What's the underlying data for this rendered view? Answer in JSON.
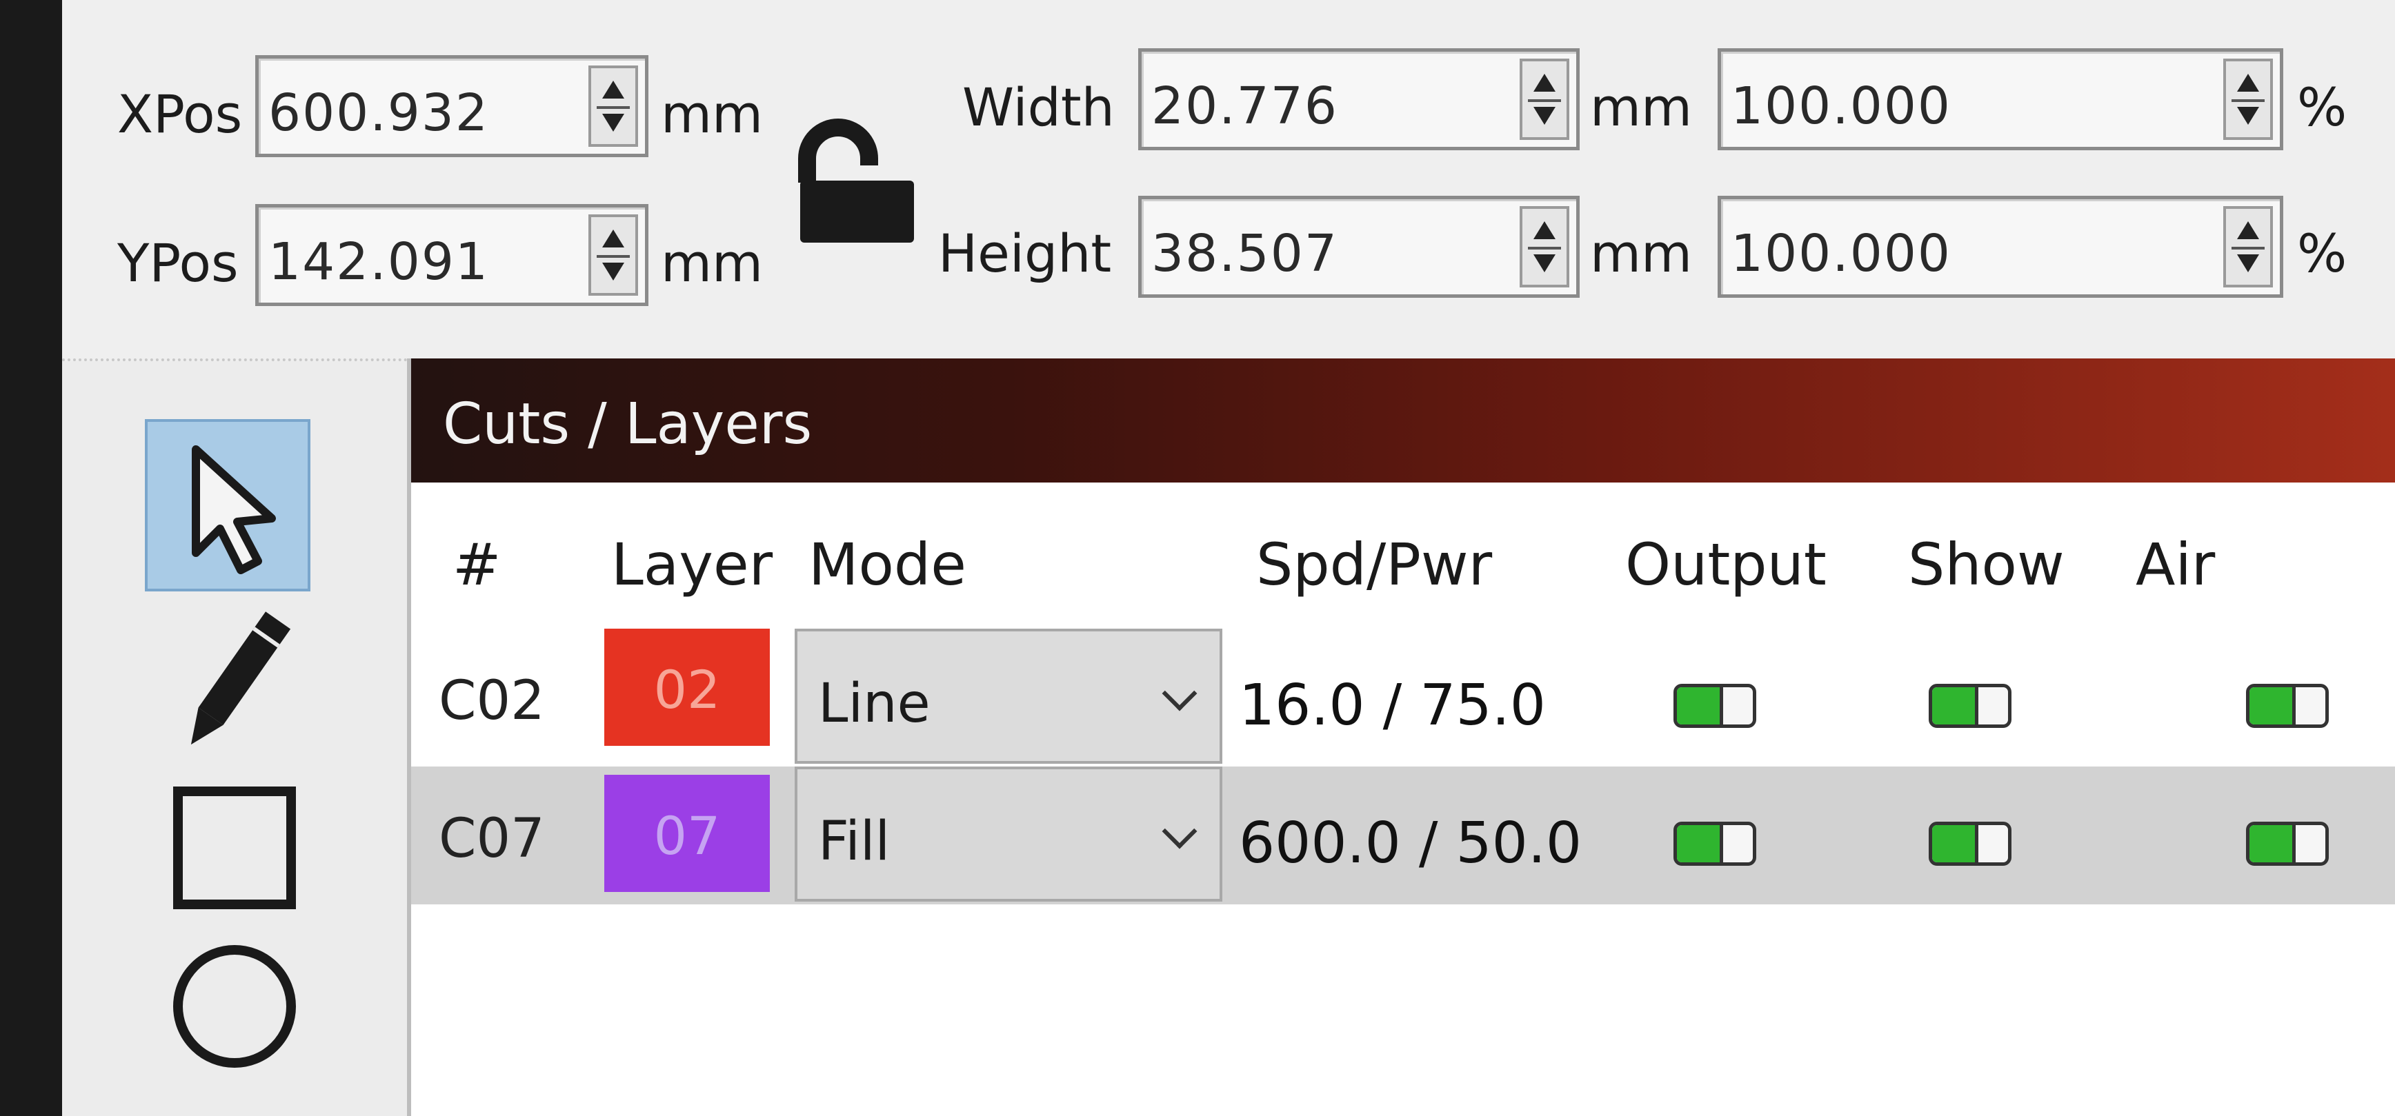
{
  "toolbar": {
    "xpos": {
      "label": "XPos",
      "value": "600.932",
      "unit": "mm"
    },
    "ypos": {
      "label": "YPos",
      "value": "142.091",
      "unit": "mm"
    },
    "width": {
      "label": "Width",
      "value": "20.776",
      "unit": "mm",
      "percent": "100.000",
      "percent_unit": "%"
    },
    "height": {
      "label": "Height",
      "value": "38.507",
      "unit": "mm",
      "percent": "100.000",
      "percent_unit": "%"
    },
    "lock_icon": "unlocked-padlock-icon"
  },
  "tools": [
    "select-arrow-icon",
    "pencil-icon",
    "rectangle-icon",
    "ellipse-icon"
  ],
  "layers_panel": {
    "title": "Cuts / Layers",
    "title_gradient": [
      "#231210",
      "#a42e1a"
    ],
    "columns": [
      "#",
      "Layer",
      "Mode",
      "Spd/Pwr",
      "Output",
      "Show",
      "Air"
    ],
    "rows": [
      {
        "id": "C02",
        "layer": "02",
        "layer_color": "#e53322",
        "mode": "Line",
        "spd_pwr": "16.0 / 75.0",
        "output": true,
        "show": true,
        "air": true
      },
      {
        "id": "C07",
        "layer": "07",
        "layer_color": "#9b3fe6",
        "mode": "Fill",
        "spd_pwr": "600.0 / 50.0",
        "output": true,
        "show": true,
        "air": true
      }
    ]
  }
}
